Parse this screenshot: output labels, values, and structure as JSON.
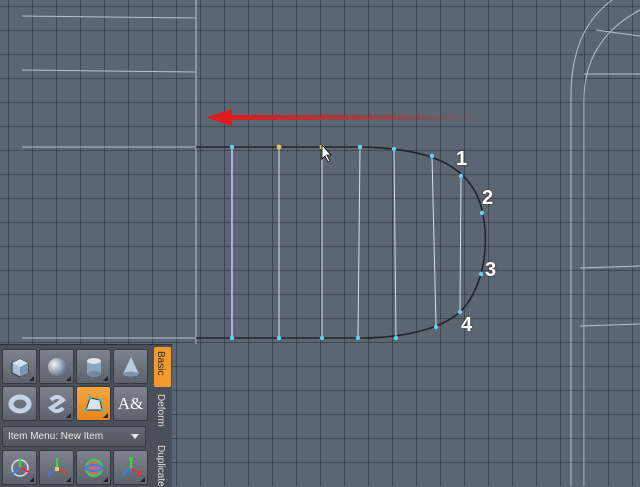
{
  "viewport": {
    "callouts": [
      "1",
      "2",
      "3",
      "4"
    ],
    "grid_color": "#5c6673",
    "arrow_color": "#e01a1a"
  },
  "toolbox": {
    "row1_tools": [
      "cube-icon",
      "sphere-icon",
      "cylinder-icon",
      "cone-icon"
    ],
    "row2_tools": [
      "torus-icon",
      "capsule-icon",
      "pen-tool-icon",
      "text-tool-icon"
    ],
    "text_tool_glyph": "A&",
    "item_menu_label": "Item Menu: New Item",
    "row3_tools": [
      "transform-icon",
      "move-icon",
      "rotate-icon",
      "scale-icon"
    ],
    "tabs": [
      "Basic",
      "Deform",
      "Duplicate"
    ],
    "active_tab": "Basic",
    "accent_color": "#f29a2e"
  }
}
